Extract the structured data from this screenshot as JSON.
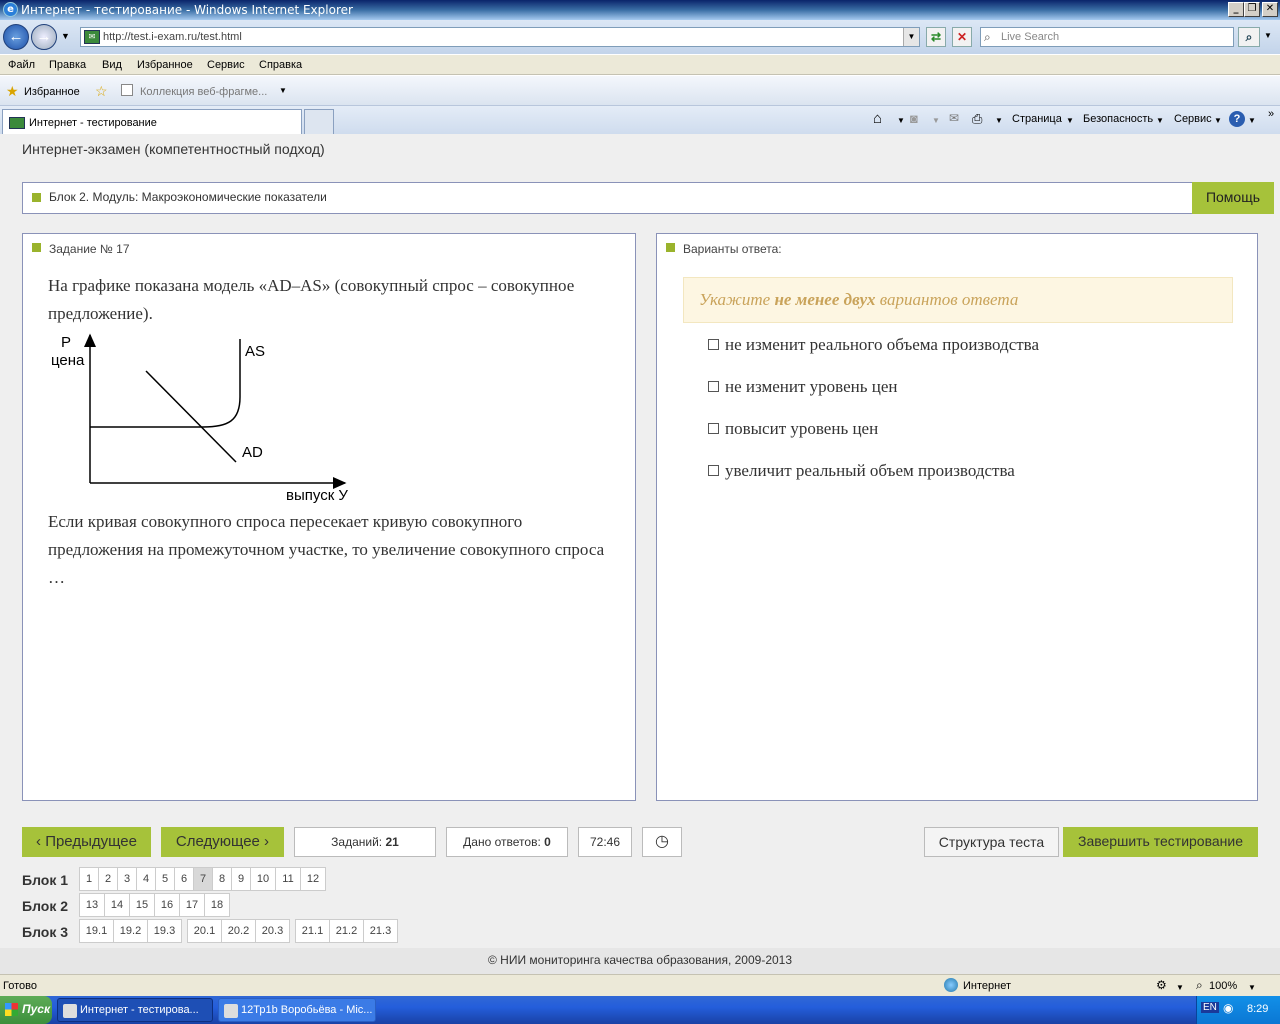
{
  "window": {
    "title": "Интернет - тестирование - Windows Internet Explorer"
  },
  "address": {
    "url": "http://test.i-exam.ru/test.html",
    "search_placeholder": "Live Search"
  },
  "menu": [
    "Файл",
    "Правка",
    "Вид",
    "Избранное",
    "Сервис",
    "Справка"
  ],
  "favorites": {
    "label": "Избранное",
    "gallery": "Коллекция веб-фрагме..."
  },
  "tab": {
    "title": "Интернет - тестирование"
  },
  "commands": {
    "page": "Страница",
    "security": "Безопасность",
    "tools": "Сервис"
  },
  "page": {
    "title": "Интернет-экзамен (компетентностный подход)",
    "block": "Блок 2. Модуль: Макроэкономические показатели",
    "help": "Помощь",
    "task_header": "Задание № 17",
    "question_intro": "На графике показана модель «AD–AS» (совокупный спрос – совокупное предложение).",
    "question_body": "Если кривая совокупного спроса пересекает кривую совокупного предложения на промежуточном участке, то увеличение совокупного спроса …",
    "answers_header": "Варианты ответа:",
    "hint_pre": "Укажите",
    "hint_bold": "не менее двух",
    "hint_post": "вариантов ответа",
    "options": [
      "не изменит реального объема производства",
      "не изменит уровень цен",
      "повысит уровень цен",
      "увеличит реальный объем производства"
    ]
  },
  "chart_data": {
    "type": "diagram",
    "y_axis_label_1": "P",
    "y_axis_label_2": "цена",
    "x_axis_label": "выпуск У",
    "curves": [
      "AS",
      "AD"
    ]
  },
  "controls": {
    "prev": "Предыдущее",
    "next": "Следующее",
    "tasks_label": "Заданий:",
    "tasks_count": "21",
    "answered_label": "Дано ответов:",
    "answered_count": "0",
    "timer": "72:46",
    "structure": "Структура теста",
    "finish": "Завершить тестирование"
  },
  "blocks": [
    {
      "label": "Блок 1",
      "items": [
        "1",
        "2",
        "3",
        "4",
        "5",
        "6",
        "7",
        "8",
        "9",
        "10",
        "11",
        "12"
      ]
    },
    {
      "label": "Блок 2",
      "items": [
        "13",
        "14",
        "15",
        "16",
        "17",
        "18"
      ]
    },
    {
      "label": "Блок 3",
      "items": [
        "19.1",
        "19.2",
        "19.3",
        "20.1",
        "20.2",
        "20.3",
        "21.1",
        "21.2",
        "21.3"
      ]
    }
  ],
  "footer": "© НИИ мониторинга качества образования, 2009-2013",
  "status": {
    "left": "Готово",
    "zone": "Интернет",
    "zoom": "100%"
  },
  "taskbar": {
    "start": "Пуск",
    "task1": "Интернет - тестирова...",
    "task2": "12Тр1b Воробьёва - Mic...",
    "lang": "EN",
    "clock": "8:29"
  }
}
